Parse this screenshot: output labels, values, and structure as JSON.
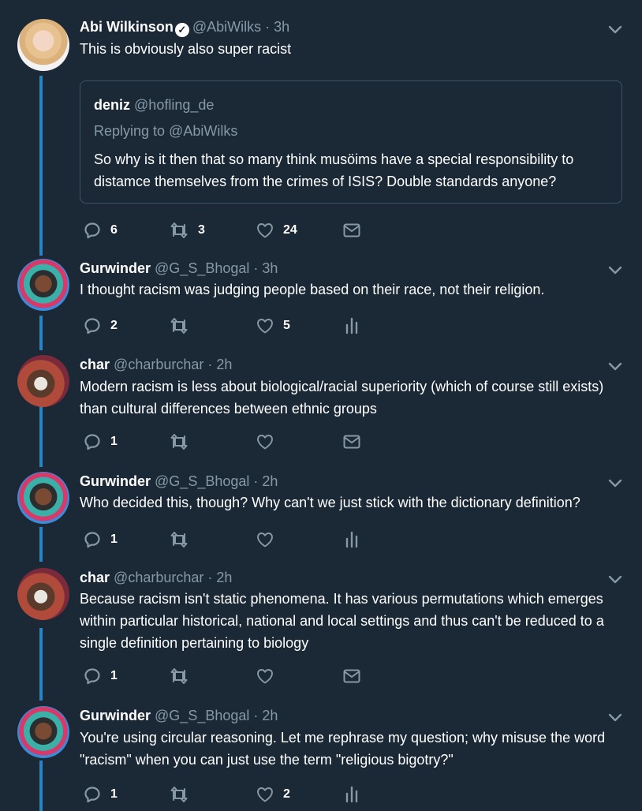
{
  "tweets": [
    {
      "name": "Abi Wilkinson",
      "handle": "@AbiWilks",
      "time": "· 3h",
      "verified": true,
      "text": "This is obviously also super racist",
      "quote": {
        "name": "deniz",
        "handle": "@hofling_de",
        "replying": "Replying to @AbiWilks",
        "text": "So why is it then that so many think musöims have a special responsibility to distamce themselves from the crimes of ISIS? Double standards anyone?"
      },
      "replies": "6",
      "retweets": "3",
      "likes": "24",
      "fourth_icon": "mail-icon"
    },
    {
      "name": "Gurwinder",
      "handle": "@G_S_Bhogal",
      "time": "· 3h",
      "text": "I thought racism was judging people based on their race, not their religion.",
      "replies": "2",
      "retweets": "",
      "likes": "5",
      "fourth_icon": "analytics-icon"
    },
    {
      "name": "char",
      "handle": "@charburchar",
      "time": "· 2h",
      "text": "Modern racism is less about biological/racial superiority (which of course still exists) than cultural differences between ethnic groups",
      "replies": "1",
      "retweets": "",
      "likes": "",
      "fourth_icon": "mail-icon"
    },
    {
      "name": "Gurwinder",
      "handle": "@G_S_Bhogal",
      "time": "· 2h",
      "text": "Who decided this, though? Why can't we just stick with the dictionary definition?",
      "replies": "1",
      "retweets": "",
      "likes": "",
      "fourth_icon": "analytics-icon"
    },
    {
      "name": "char",
      "handle": "@charburchar",
      "time": "· 2h",
      "text": "Because racism isn't static phenomena. It has various permutations which emerges within particular historical, national and local settings and thus can't be reduced to a single definition pertaining to biology",
      "replies": "1",
      "retweets": "",
      "likes": "",
      "fourth_icon": "mail-icon"
    },
    {
      "name": "Gurwinder",
      "handle": "@G_S_Bhogal",
      "time": "· 2h",
      "text": "You're using circular reasoning. Let me rephrase my question; why misuse the word \"racism\" when you can just use the term \"religious bigotry?\"",
      "replies": "1",
      "retweets": "",
      "likes": "2",
      "fourth_icon": "analytics-icon"
    }
  ],
  "colors": {
    "background": "#1b2836",
    "thread_line": "#2a84c3",
    "secondary_text": "#8899a6",
    "quote_border": "#3d5466"
  }
}
